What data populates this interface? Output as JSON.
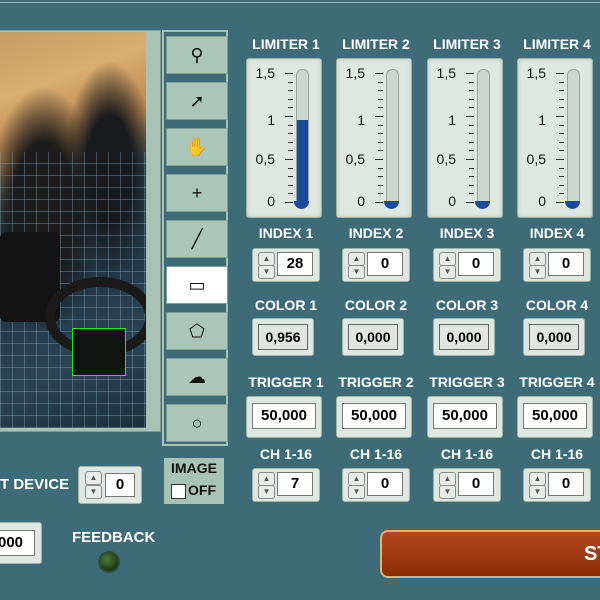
{
  "toolbar": {
    "tools": [
      {
        "icon": "zoom-icon",
        "glyph": "⚲"
      },
      {
        "icon": "arrow-pointer-icon",
        "glyph": "➚"
      },
      {
        "icon": "hand-pan-icon",
        "glyph": "✋"
      },
      {
        "icon": "crosshair-icon",
        "glyph": "+"
      },
      {
        "icon": "line-tool-icon",
        "glyph": "╱"
      },
      {
        "icon": "rectangle-tool-icon",
        "glyph": "▭"
      },
      {
        "icon": "polygon-tool-icon",
        "glyph": "⬠"
      },
      {
        "icon": "freehand-tool-icon",
        "glyph": "☁"
      },
      {
        "icon": "ellipse-tool-icon",
        "glyph": "○"
      }
    ],
    "selected": "rectangle-tool-icon"
  },
  "image_toggle": {
    "label": "IMAGE",
    "state": "OFF"
  },
  "channels": [
    {
      "limiter": "LIMITER 1",
      "level": 0.95,
      "index_label": "INDEX 1",
      "index": "28",
      "color_label": "COLOR 1",
      "color": "0,956",
      "trigger_label": "TRIGGER 1",
      "trigger": "50,000",
      "ch_label": "CH 1-16",
      "ch": "7"
    },
    {
      "limiter": "LIMITER 2",
      "level": 0.0,
      "index_label": "INDEX 2",
      "index": "0",
      "color_label": "COLOR 2",
      "color": "0,000",
      "trigger_label": "TRIGGER 2",
      "trigger": "50,000",
      "ch_label": "CH 1-16",
      "ch": "0"
    },
    {
      "limiter": "LIMITER 3",
      "level": 0.0,
      "index_label": "INDEX 3",
      "index": "0",
      "color_label": "COLOR 3",
      "color": "0,000",
      "trigger_label": "TRIGGER 3",
      "trigger": "50,000",
      "ch_label": "CH 1-16",
      "ch": "0"
    },
    {
      "limiter": "LIMITER 4",
      "level": 0.0,
      "index_label": "INDEX 4",
      "index": "0",
      "color_label": "COLOR 4",
      "color": "0,000",
      "trigger_label": "TRIGGER 4",
      "trigger": "50,000",
      "ch_label": "CH 1-16",
      "ch": "0"
    }
  ],
  "gauge_scale": {
    "max": 1.5,
    "labels": [
      "1,5",
      "1",
      "0,5",
      "0"
    ]
  },
  "device": {
    "label": "T DEVICE",
    "value": "0"
  },
  "left_value": "000",
  "feedback": {
    "label": "FEEDBACK"
  },
  "start_button": {
    "label": "ST"
  },
  "colors": {
    "background": "#3d6b78",
    "panel": "#a9c2b6",
    "fill": "#1b4a9c",
    "start": "#a63a10"
  }
}
